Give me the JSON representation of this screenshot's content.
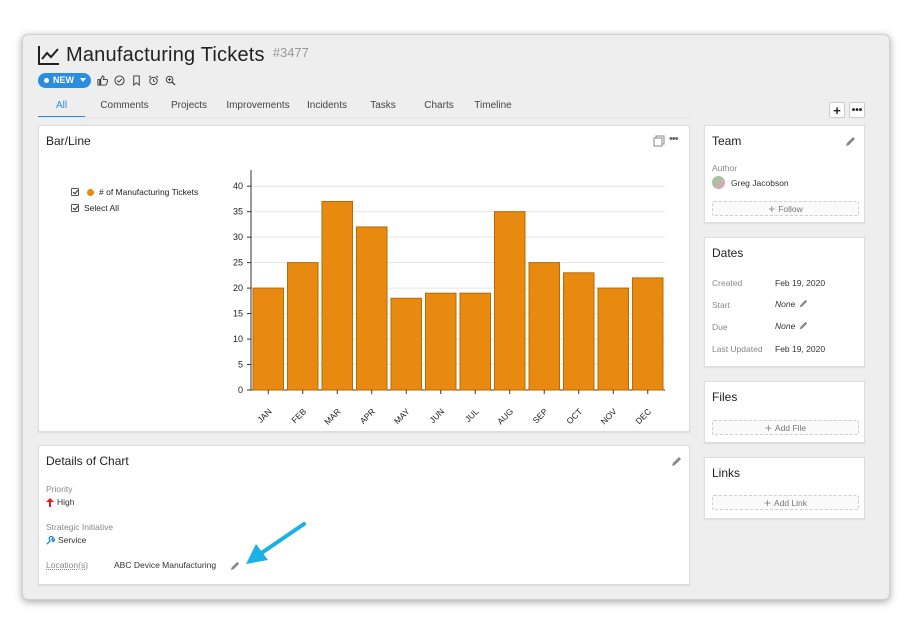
{
  "header": {
    "title": "Manufacturing Tickets",
    "ticket_id": "#3477",
    "status": "NEW"
  },
  "tabs": [
    "All",
    "Comments",
    "Projects",
    "Improvements",
    "Incidents",
    "Tasks",
    "Charts",
    "Timeline"
  ],
  "chart_panel": {
    "title": "Bar/Line",
    "legend_series": "# of Manufacturing Tickets",
    "select_all": "Select All"
  },
  "chart_data": {
    "type": "bar",
    "categories": [
      "JAN",
      "FEB",
      "MAR",
      "APR",
      "MAY",
      "JUN",
      "JUL",
      "AUG",
      "SEP",
      "OCT",
      "NOV",
      "DEC"
    ],
    "series": [
      {
        "name": "# of Manufacturing Tickets",
        "values": [
          20,
          25,
          37,
          32,
          18,
          19,
          19,
          35,
          25,
          23,
          20,
          22
        ]
      }
    ],
    "ylim": [
      0,
      42
    ],
    "yticks": [
      "0",
      "5",
      "10",
      "15",
      "20",
      "25",
      "30",
      "35",
      "40"
    ],
    "bar_color": "#e88a10",
    "grid": true,
    "legend_position": "top-left"
  },
  "details": {
    "title": "Details of Chart",
    "priority_label": "Priority",
    "priority_value": "High",
    "initiative_label": "Strategic Initiative",
    "initiative_value": "Service",
    "location_label": "Location(s)",
    "location_value": "ABC Device Manufacturing"
  },
  "team": {
    "title": "Team",
    "author_label": "Author",
    "author_name": "Greg Jacobson",
    "follow_label": "Follow"
  },
  "dates": {
    "title": "Dates",
    "created_label": "Created",
    "created_value": "Feb 19, 2020",
    "start_label": "Start",
    "start_value": "None",
    "due_label": "Due",
    "due_value": "None",
    "updated_label": "Last Updated",
    "updated_value": "Feb 19, 2020"
  },
  "files": {
    "title": "Files",
    "add_label": "Add File"
  },
  "links": {
    "title": "Links",
    "add_label": "Add Link"
  },
  "colors": {
    "accent": "#2a8de0",
    "bar": "#e88a10",
    "priority_high": "#e02020",
    "annotation_arrow": "#1ab1e6"
  }
}
